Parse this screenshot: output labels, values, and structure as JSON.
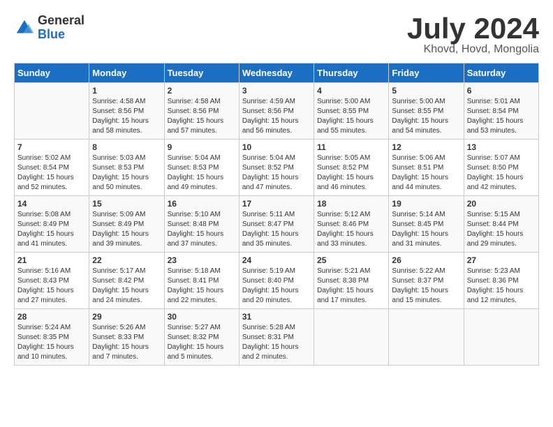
{
  "header": {
    "logo_general": "General",
    "logo_blue": "Blue",
    "main_title": "July 2024",
    "subtitle": "Khovd, Hovd, Mongolia"
  },
  "calendar": {
    "days_of_week": [
      "Sunday",
      "Monday",
      "Tuesday",
      "Wednesday",
      "Thursday",
      "Friday",
      "Saturday"
    ],
    "weeks": [
      [
        {
          "day": "",
          "info": ""
        },
        {
          "day": "1",
          "info": "Sunrise: 4:58 AM\nSunset: 8:56 PM\nDaylight: 15 hours\nand 58 minutes."
        },
        {
          "day": "2",
          "info": "Sunrise: 4:58 AM\nSunset: 8:56 PM\nDaylight: 15 hours\nand 57 minutes."
        },
        {
          "day": "3",
          "info": "Sunrise: 4:59 AM\nSunset: 8:56 PM\nDaylight: 15 hours\nand 56 minutes."
        },
        {
          "day": "4",
          "info": "Sunrise: 5:00 AM\nSunset: 8:55 PM\nDaylight: 15 hours\nand 55 minutes."
        },
        {
          "day": "5",
          "info": "Sunrise: 5:00 AM\nSunset: 8:55 PM\nDaylight: 15 hours\nand 54 minutes."
        },
        {
          "day": "6",
          "info": "Sunrise: 5:01 AM\nSunset: 8:54 PM\nDaylight: 15 hours\nand 53 minutes."
        }
      ],
      [
        {
          "day": "7",
          "info": "Sunrise: 5:02 AM\nSunset: 8:54 PM\nDaylight: 15 hours\nand 52 minutes."
        },
        {
          "day": "8",
          "info": "Sunrise: 5:03 AM\nSunset: 8:53 PM\nDaylight: 15 hours\nand 50 minutes."
        },
        {
          "day": "9",
          "info": "Sunrise: 5:04 AM\nSunset: 8:53 PM\nDaylight: 15 hours\nand 49 minutes."
        },
        {
          "day": "10",
          "info": "Sunrise: 5:04 AM\nSunset: 8:52 PM\nDaylight: 15 hours\nand 47 minutes."
        },
        {
          "day": "11",
          "info": "Sunrise: 5:05 AM\nSunset: 8:52 PM\nDaylight: 15 hours\nand 46 minutes."
        },
        {
          "day": "12",
          "info": "Sunrise: 5:06 AM\nSunset: 8:51 PM\nDaylight: 15 hours\nand 44 minutes."
        },
        {
          "day": "13",
          "info": "Sunrise: 5:07 AM\nSunset: 8:50 PM\nDaylight: 15 hours\nand 42 minutes."
        }
      ],
      [
        {
          "day": "14",
          "info": "Sunrise: 5:08 AM\nSunset: 8:49 PM\nDaylight: 15 hours\nand 41 minutes."
        },
        {
          "day": "15",
          "info": "Sunrise: 5:09 AM\nSunset: 8:49 PM\nDaylight: 15 hours\nand 39 minutes."
        },
        {
          "day": "16",
          "info": "Sunrise: 5:10 AM\nSunset: 8:48 PM\nDaylight: 15 hours\nand 37 minutes."
        },
        {
          "day": "17",
          "info": "Sunrise: 5:11 AM\nSunset: 8:47 PM\nDaylight: 15 hours\nand 35 minutes."
        },
        {
          "day": "18",
          "info": "Sunrise: 5:12 AM\nSunset: 8:46 PM\nDaylight: 15 hours\nand 33 minutes."
        },
        {
          "day": "19",
          "info": "Sunrise: 5:14 AM\nSunset: 8:45 PM\nDaylight: 15 hours\nand 31 minutes."
        },
        {
          "day": "20",
          "info": "Sunrise: 5:15 AM\nSunset: 8:44 PM\nDaylight: 15 hours\nand 29 minutes."
        }
      ],
      [
        {
          "day": "21",
          "info": "Sunrise: 5:16 AM\nSunset: 8:43 PM\nDaylight: 15 hours\nand 27 minutes."
        },
        {
          "day": "22",
          "info": "Sunrise: 5:17 AM\nSunset: 8:42 PM\nDaylight: 15 hours\nand 24 minutes."
        },
        {
          "day": "23",
          "info": "Sunrise: 5:18 AM\nSunset: 8:41 PM\nDaylight: 15 hours\nand 22 minutes."
        },
        {
          "day": "24",
          "info": "Sunrise: 5:19 AM\nSunset: 8:40 PM\nDaylight: 15 hours\nand 20 minutes."
        },
        {
          "day": "25",
          "info": "Sunrise: 5:21 AM\nSunset: 8:38 PM\nDaylight: 15 hours\nand 17 minutes."
        },
        {
          "day": "26",
          "info": "Sunrise: 5:22 AM\nSunset: 8:37 PM\nDaylight: 15 hours\nand 15 minutes."
        },
        {
          "day": "27",
          "info": "Sunrise: 5:23 AM\nSunset: 8:36 PM\nDaylight: 15 hours\nand 12 minutes."
        }
      ],
      [
        {
          "day": "28",
          "info": "Sunrise: 5:24 AM\nSunset: 8:35 PM\nDaylight: 15 hours\nand 10 minutes."
        },
        {
          "day": "29",
          "info": "Sunrise: 5:26 AM\nSunset: 8:33 PM\nDaylight: 15 hours\nand 7 minutes."
        },
        {
          "day": "30",
          "info": "Sunrise: 5:27 AM\nSunset: 8:32 PM\nDaylight: 15 hours\nand 5 minutes."
        },
        {
          "day": "31",
          "info": "Sunrise: 5:28 AM\nSunset: 8:31 PM\nDaylight: 15 hours\nand 2 minutes."
        },
        {
          "day": "",
          "info": ""
        },
        {
          "day": "",
          "info": ""
        },
        {
          "day": "",
          "info": ""
        }
      ]
    ]
  }
}
